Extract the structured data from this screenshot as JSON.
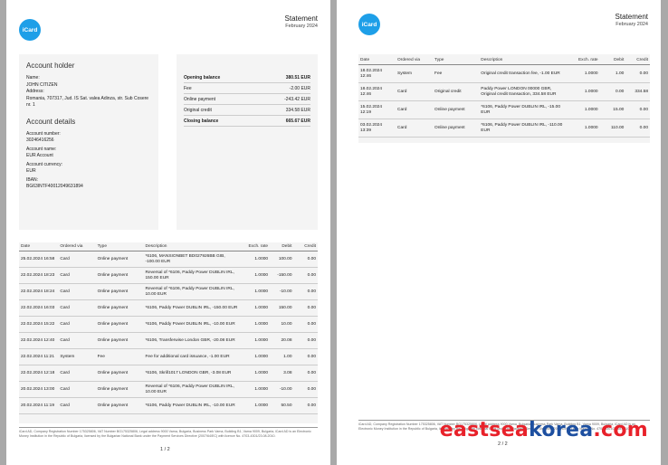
{
  "brand": {
    "logo_text": "iCard",
    "color": "#1e9fe8"
  },
  "statement": {
    "title": "Statement",
    "period": "February 2024"
  },
  "account_holder": {
    "heading": "Account holder",
    "name_label": "Name:",
    "name": "JOHN CITIZEN",
    "address_label": "Address:",
    "address": "Romania, 707317, Jud. IS Sat. valea Adinza, str. Sub Cosere nr. 1"
  },
  "account_details": {
    "heading": "Account details",
    "number_label": "Account number:",
    "number": "30246416256",
    "name_label": "Account name:",
    "name": "EUR Account",
    "currency_label": "Account currency:",
    "currency": "EUR",
    "iban_label": "IBAN:",
    "iban": "BG63INTF40012049631894"
  },
  "balances": [
    {
      "label": "Opening balance",
      "value": "380.51 EUR",
      "bold": true
    },
    {
      "label": "Fee",
      "value": "-2.00 EUR",
      "bold": false
    },
    {
      "label": "Online payment",
      "value": "-243.42 EUR",
      "bold": false
    },
    {
      "label": "Original credit",
      "value": "334.58 EUR",
      "bold": false
    },
    {
      "label": "Closing balance",
      "value": "665.67 EUR",
      "bold": true
    }
  ],
  "columns": {
    "date": "Date",
    "via": "Ordered via",
    "type": "Type",
    "desc": "Description",
    "rate": "Exch. rate",
    "debit": "Debit",
    "credit": "Credit"
  },
  "page1_rows": [
    {
      "date": "25.02.2024 16:58",
      "via": "Card",
      "type": "Online payment",
      "desc": "*6106, MANSIONBET BD027926BB GIB, -100.00 EUR",
      "rate": "1.0000",
      "debit": "100.00",
      "credit": "0.00"
    },
    {
      "date": "22.02.2024 18:23",
      "via": "Card",
      "type": "Online payment",
      "desc": "Reversal of *6106, Paddy Power DUBLIN IRL, 150.00 EUR",
      "rate": "1.0000",
      "debit": "-150.00",
      "credit": "0.00"
    },
    {
      "date": "22.02.2024 18:24",
      "via": "Card",
      "type": "Online payment",
      "desc": "Reversal of *6106, Paddy Power DUBLIN IRL, 10.00 EUR",
      "rate": "1.0000",
      "debit": "-10.00",
      "credit": "0.00"
    },
    {
      "date": "22.02.2024 16:03",
      "via": "Card",
      "type": "Online payment",
      "desc": "*6106, Paddy Power DUBLIN IRL, -150.00 EUR",
      "rate": "1.0000",
      "debit": "150.00",
      "credit": "0.00"
    },
    {
      "date": "22.02.2024 15:22",
      "via": "Card",
      "type": "Online payment",
      "desc": "*6106, Paddy Power DUBLIN IRL, -10.00 EUR",
      "rate": "1.0000",
      "debit": "10.00",
      "credit": "0.00"
    },
    {
      "date": "22.02.2024 12:40",
      "via": "Card",
      "type": "Online payment",
      "desc": "*6106, Transferwise London GBR, -20.08 EUR",
      "rate": "1.0000",
      "debit": "20.08",
      "credit": "0.00"
    },
    {
      "date": "22.02.2024 11:21",
      "via": "System",
      "type": "Fee",
      "desc": "Fee for additional card issuance, -1.00 EUR",
      "rate": "1.0000",
      "debit": "1.00",
      "credit": "0.00"
    },
    {
      "date": "22.02.2024 12:18",
      "via": "Card",
      "type": "Online payment",
      "desc": "*6106, Skrill1017 LONDON GBR, -3.08 EUR",
      "rate": "1.0000",
      "debit": "3.08",
      "credit": "0.00"
    },
    {
      "date": "20.02.2024 13:00",
      "via": "Card",
      "type": "Online payment",
      "desc": "Reversal of *6106, Paddy Power DUBLIN IRL, 10.00 EUR",
      "rate": "1.0000",
      "debit": "-10.00",
      "credit": "0.00"
    },
    {
      "date": "20.02.2024 11:19",
      "via": "Card",
      "type": "Online payment",
      "desc": "*6106, Paddy Power DUBLIN IRL, -10.00 EUR",
      "rate": "1.0000",
      "debit": "50.50",
      "credit": "0.00"
    }
  ],
  "page2_rows": [
    {
      "date": "18.02.2024 12:46",
      "via": "System",
      "type": "Fee",
      "desc": "Original credit transaction fee, -1.00 EUR",
      "rate": "1.0000",
      "debit": "1.00",
      "credit": "0.00"
    },
    {
      "date": "18.02.2024 12:46",
      "via": "Card",
      "type": "Original credit",
      "desc": "Paddy Power LONDON 00000 GBR, Original credit transaction, 334.58 EUR",
      "rate": "1.0000",
      "debit": "0.00",
      "credit": "334.58"
    },
    {
      "date": "15.02.2024 12:19",
      "via": "Card",
      "type": "Online payment",
      "desc": "*6106, Paddy Power DUBLIN IRL, -15.00 EUR",
      "rate": "1.0000",
      "debit": "15.00",
      "credit": "0.00"
    },
    {
      "date": "03.02.2024 13:39",
      "via": "Card",
      "type": "Online payment",
      "desc": "*6106, Paddy Power DUBLIN IRL, -110.00 EUR",
      "rate": "1.0000",
      "debit": "110.00",
      "credit": "0.00"
    }
  ],
  "footer": "iCard AD, Company Registration Number 175325806, VAT Number BG175325806, Legal address 9000 Varna, Bulgaria, Business Park Varna, Building B1, Varna 9009, Bulgaria, iCard AD is an Electronic Money Institution in the Republic of Bulgaria, licensed by the Bulgarian National Bank under the Payment Services Directive (2007/64/EC) with licence No. 4703-4301/23.08.2010.",
  "page1_number": "1 / 2",
  "page2_number": "2 / 2",
  "watermark": {
    "part1": "eastsea",
    "part2": "korea",
    "part3": ".com"
  }
}
